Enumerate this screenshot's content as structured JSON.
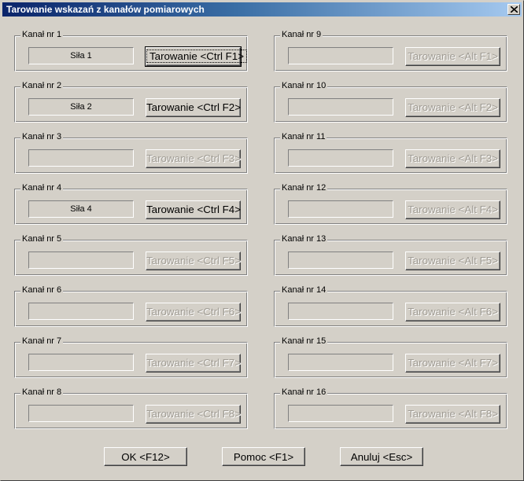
{
  "window": {
    "title": "Tarowanie wskazań z kanałów pomiarowych"
  },
  "left_channels": [
    {
      "legend": "Kanał nr 1",
      "value": "Siła 1",
      "button": "Tarowanie <Ctrl F1>",
      "enabled": true,
      "focused": true
    },
    {
      "legend": "Kanał nr 2",
      "value": "Siła 2",
      "button": "Tarowanie <Ctrl F2>",
      "enabled": true,
      "focused": false
    },
    {
      "legend": "Kanał nr 3",
      "value": "",
      "button": "Tarowanie <Ctrl F3>",
      "enabled": false,
      "focused": false
    },
    {
      "legend": "Kanał nr 4",
      "value": "Siła 4",
      "button": "Tarowanie <Ctrl F4>",
      "enabled": true,
      "focused": false
    },
    {
      "legend": "Kanał nr 5",
      "value": "",
      "button": "Tarowanie <Ctrl F5>",
      "enabled": false,
      "focused": false
    },
    {
      "legend": "Kanał nr 6",
      "value": "",
      "button": "Tarowanie <Ctrl F6>",
      "enabled": false,
      "focused": false
    },
    {
      "legend": "Kanał nr 7",
      "value": "",
      "button": "Tarowanie <Ctrl F7>",
      "enabled": false,
      "focused": false
    },
    {
      "legend": "Kanał nr 8",
      "value": "",
      "button": "Tarowanie <Ctrl F8>",
      "enabled": false,
      "focused": false
    }
  ],
  "right_channels": [
    {
      "legend": "Kanał nr 9",
      "value": "",
      "button": "Tarowanie <Alt F1>",
      "enabled": false,
      "focused": false
    },
    {
      "legend": "Kanał nr 10",
      "value": "",
      "button": "Tarowanie <Alt F2>",
      "enabled": false,
      "focused": false
    },
    {
      "legend": "Kanał nr 11",
      "value": "",
      "button": "Tarowanie <Alt F3>",
      "enabled": false,
      "focused": false
    },
    {
      "legend": "Kanał nr 12",
      "value": "",
      "button": "Tarowanie <Alt F4>",
      "enabled": false,
      "focused": false
    },
    {
      "legend": "Kanał nr 13",
      "value": "",
      "button": "Tarowanie <Alt F5>",
      "enabled": false,
      "focused": false
    },
    {
      "legend": "Kanał nr 14",
      "value": "",
      "button": "Tarowanie <Alt F6>",
      "enabled": false,
      "focused": false
    },
    {
      "legend": "Kanał nr 15",
      "value": "",
      "button": "Tarowanie <Alt F7>",
      "enabled": false,
      "focused": false
    },
    {
      "legend": "Kanał nr 16",
      "value": "",
      "button": "Tarowanie <Alt F8>",
      "enabled": false,
      "focused": false
    }
  ],
  "footer": {
    "ok_label": "OK <F12>",
    "help_label": "Pomoc <F1>",
    "cancel_label": "Anuluj <Esc>"
  },
  "icons": {
    "close": "close-icon"
  }
}
